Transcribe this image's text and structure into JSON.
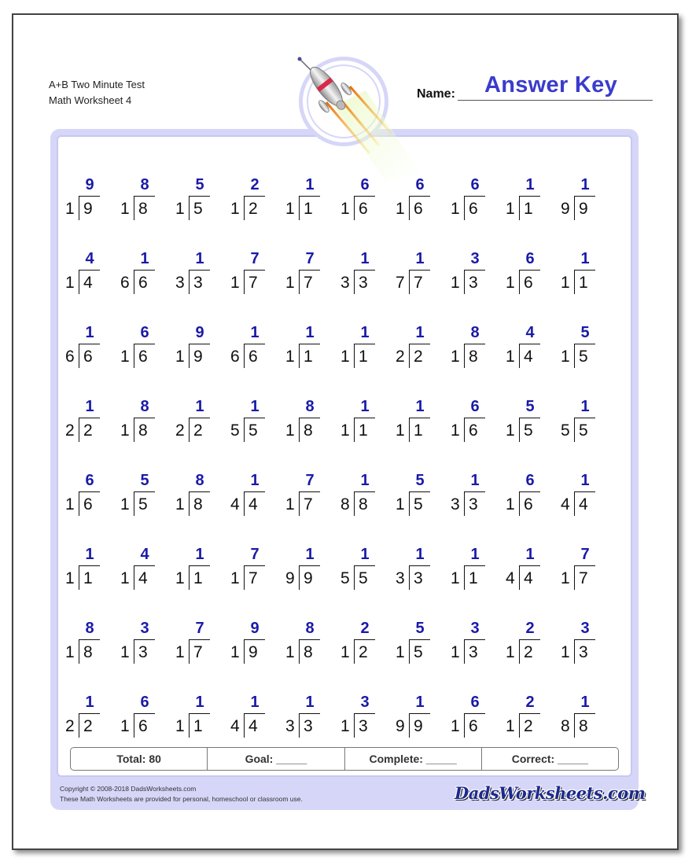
{
  "header": {
    "title_line1": "A+B Two Minute Test",
    "title_line2": "Math Worksheet 4",
    "name_label": "Name:",
    "name_value": "Answer Key"
  },
  "colors": {
    "accent": "#3a3ccc",
    "answer": "#1a1aa8",
    "frame": "#d6d6f8"
  },
  "problems": [
    [
      {
        "d": "1",
        "n": "9",
        "q": "9"
      },
      {
        "d": "1",
        "n": "8",
        "q": "8"
      },
      {
        "d": "1",
        "n": "5",
        "q": "5"
      },
      {
        "d": "1",
        "n": "2",
        "q": "2"
      },
      {
        "d": "1",
        "n": "1",
        "q": "1"
      },
      {
        "d": "1",
        "n": "6",
        "q": "6"
      },
      {
        "d": "1",
        "n": "6",
        "q": "6"
      },
      {
        "d": "1",
        "n": "6",
        "q": "6"
      },
      {
        "d": "1",
        "n": "1",
        "q": "1"
      },
      {
        "d": "9",
        "n": "9",
        "q": "1"
      }
    ],
    [
      {
        "d": "1",
        "n": "4",
        "q": "4"
      },
      {
        "d": "6",
        "n": "6",
        "q": "1"
      },
      {
        "d": "3",
        "n": "3",
        "q": "1"
      },
      {
        "d": "1",
        "n": "7",
        "q": "7"
      },
      {
        "d": "1",
        "n": "7",
        "q": "7"
      },
      {
        "d": "3",
        "n": "3",
        "q": "1"
      },
      {
        "d": "7",
        "n": "7",
        "q": "1"
      },
      {
        "d": "1",
        "n": "3",
        "q": "3"
      },
      {
        "d": "1",
        "n": "6",
        "q": "6"
      },
      {
        "d": "1",
        "n": "1",
        "q": "1"
      }
    ],
    [
      {
        "d": "6",
        "n": "6",
        "q": "1"
      },
      {
        "d": "1",
        "n": "6",
        "q": "6"
      },
      {
        "d": "1",
        "n": "9",
        "q": "9"
      },
      {
        "d": "6",
        "n": "6",
        "q": "1"
      },
      {
        "d": "1",
        "n": "1",
        "q": "1"
      },
      {
        "d": "1",
        "n": "1",
        "q": "1"
      },
      {
        "d": "2",
        "n": "2",
        "q": "1"
      },
      {
        "d": "1",
        "n": "8",
        "q": "8"
      },
      {
        "d": "1",
        "n": "4",
        "q": "4"
      },
      {
        "d": "1",
        "n": "5",
        "q": "5"
      }
    ],
    [
      {
        "d": "2",
        "n": "2",
        "q": "1"
      },
      {
        "d": "1",
        "n": "8",
        "q": "8"
      },
      {
        "d": "2",
        "n": "2",
        "q": "1"
      },
      {
        "d": "5",
        "n": "5",
        "q": "1"
      },
      {
        "d": "1",
        "n": "8",
        "q": "8"
      },
      {
        "d": "1",
        "n": "1",
        "q": "1"
      },
      {
        "d": "1",
        "n": "1",
        "q": "1"
      },
      {
        "d": "1",
        "n": "6",
        "q": "6"
      },
      {
        "d": "1",
        "n": "5",
        "q": "5"
      },
      {
        "d": "5",
        "n": "5",
        "q": "1"
      }
    ],
    [
      {
        "d": "1",
        "n": "6",
        "q": "6"
      },
      {
        "d": "1",
        "n": "5",
        "q": "5"
      },
      {
        "d": "1",
        "n": "8",
        "q": "8"
      },
      {
        "d": "4",
        "n": "4",
        "q": "1"
      },
      {
        "d": "1",
        "n": "7",
        "q": "7"
      },
      {
        "d": "8",
        "n": "8",
        "q": "1"
      },
      {
        "d": "1",
        "n": "5",
        "q": "5"
      },
      {
        "d": "3",
        "n": "3",
        "q": "1"
      },
      {
        "d": "1",
        "n": "6",
        "q": "6"
      },
      {
        "d": "4",
        "n": "4",
        "q": "1"
      }
    ],
    [
      {
        "d": "1",
        "n": "1",
        "q": "1"
      },
      {
        "d": "1",
        "n": "4",
        "q": "4"
      },
      {
        "d": "1",
        "n": "1",
        "q": "1"
      },
      {
        "d": "1",
        "n": "7",
        "q": "7"
      },
      {
        "d": "9",
        "n": "9",
        "q": "1"
      },
      {
        "d": "5",
        "n": "5",
        "q": "1"
      },
      {
        "d": "3",
        "n": "3",
        "q": "1"
      },
      {
        "d": "1",
        "n": "1",
        "q": "1"
      },
      {
        "d": "4",
        "n": "4",
        "q": "1"
      },
      {
        "d": "1",
        "n": "7",
        "q": "7"
      }
    ],
    [
      {
        "d": "1",
        "n": "8",
        "q": "8"
      },
      {
        "d": "1",
        "n": "3",
        "q": "3"
      },
      {
        "d": "1",
        "n": "7",
        "q": "7"
      },
      {
        "d": "1",
        "n": "9",
        "q": "9"
      },
      {
        "d": "1",
        "n": "8",
        "q": "8"
      },
      {
        "d": "1",
        "n": "2",
        "q": "2"
      },
      {
        "d": "1",
        "n": "5",
        "q": "5"
      },
      {
        "d": "1",
        "n": "3",
        "q": "3"
      },
      {
        "d": "1",
        "n": "2",
        "q": "2"
      },
      {
        "d": "1",
        "n": "3",
        "q": "3"
      }
    ],
    [
      {
        "d": "2",
        "n": "2",
        "q": "1"
      },
      {
        "d": "1",
        "n": "6",
        "q": "6"
      },
      {
        "d": "1",
        "n": "1",
        "q": "1"
      },
      {
        "d": "4",
        "n": "4",
        "q": "1"
      },
      {
        "d": "3",
        "n": "3",
        "q": "1"
      },
      {
        "d": "1",
        "n": "3",
        "q": "3"
      },
      {
        "d": "9",
        "n": "9",
        "q": "1"
      },
      {
        "d": "1",
        "n": "6",
        "q": "6"
      },
      {
        "d": "1",
        "n": "2",
        "q": "2"
      },
      {
        "d": "8",
        "n": "8",
        "q": "1"
      }
    ]
  ],
  "stats": {
    "total": "Total: 80",
    "goal": "Goal: _____",
    "complete": "Complete: _____",
    "correct": "Correct: _____"
  },
  "footer": {
    "copyright": "Copyright © 2008-2018 DadsWorksheets.com",
    "usage": "These Math Worksheets are provided for personal, homeschool or classroom use.",
    "brand": "DadsWorksheets.com"
  }
}
